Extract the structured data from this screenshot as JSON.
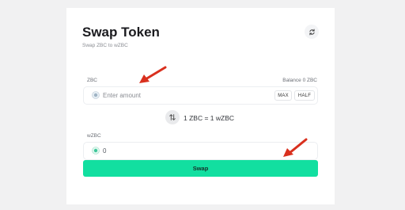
{
  "header": {
    "title": "Swap Token",
    "subtitle": "Swap ZBC to wZBC",
    "refresh_icon": "refresh-icon"
  },
  "from": {
    "label": "ZBC",
    "balance": "Balance 0 ZBC",
    "placeholder": "Enter amount",
    "value": "",
    "icon": "zbc-token-icon",
    "max_label": "MAX",
    "half_label": "HALF"
  },
  "rate": {
    "icon": "swap-direction-icon",
    "text": "1 ZBC = 1 wZBC"
  },
  "to": {
    "label": "wZBC",
    "value": "0",
    "icon": "wzbc-token-icon"
  },
  "action": {
    "swap_label": "Swap"
  },
  "colors": {
    "accent": "#12dfa0",
    "annotation_arrow": "#d9301e",
    "background": "#f1f1f2",
    "card": "#ffffff"
  }
}
